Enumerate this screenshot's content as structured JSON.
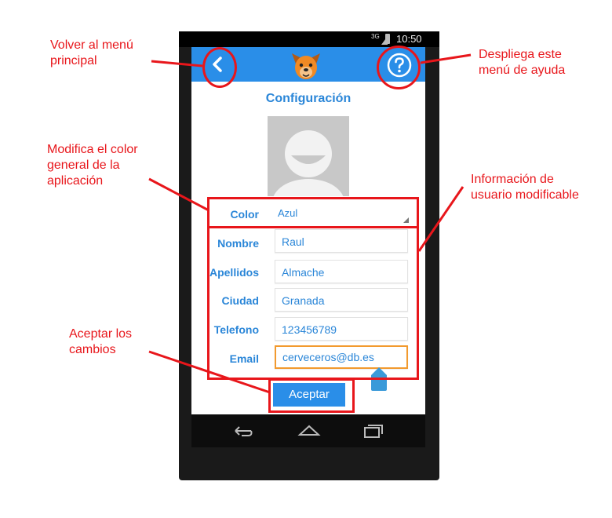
{
  "annotations": {
    "back": [
      "Volver al menú",
      "principal"
    ],
    "help": [
      "Despliega este",
      "menú de ayuda"
    ],
    "color": [
      "Modifica el color",
      "general de la",
      "aplicación"
    ],
    "user_info": [
      "Información de",
      "usuario modificable"
    ],
    "accept": [
      "Aceptar los",
      "cambios"
    ]
  },
  "status_bar": {
    "network": "3G",
    "time": "10:50"
  },
  "app_bar": {
    "back_icon": "chevron-left-icon",
    "logo_icon": "dog-logo-icon",
    "help_icon": "question-mark-icon"
  },
  "screen": {
    "title": "Configuración",
    "color_row": {
      "label": "Color",
      "value": "Azul"
    },
    "fields": [
      {
        "label": "Nombre",
        "value": "Raul"
      },
      {
        "label": "Apellidos",
        "value": "Almache"
      },
      {
        "label": "Ciudad",
        "value": "Granada"
      },
      {
        "label": "Telefono",
        "value": "123456789"
      },
      {
        "label": "Email",
        "value": "cerveceros@db.es"
      }
    ],
    "accept_label": "Aceptar"
  },
  "colors": {
    "accent": "#2a8ee8",
    "annotation": "#e8161b",
    "focus": "#f29a2e"
  }
}
